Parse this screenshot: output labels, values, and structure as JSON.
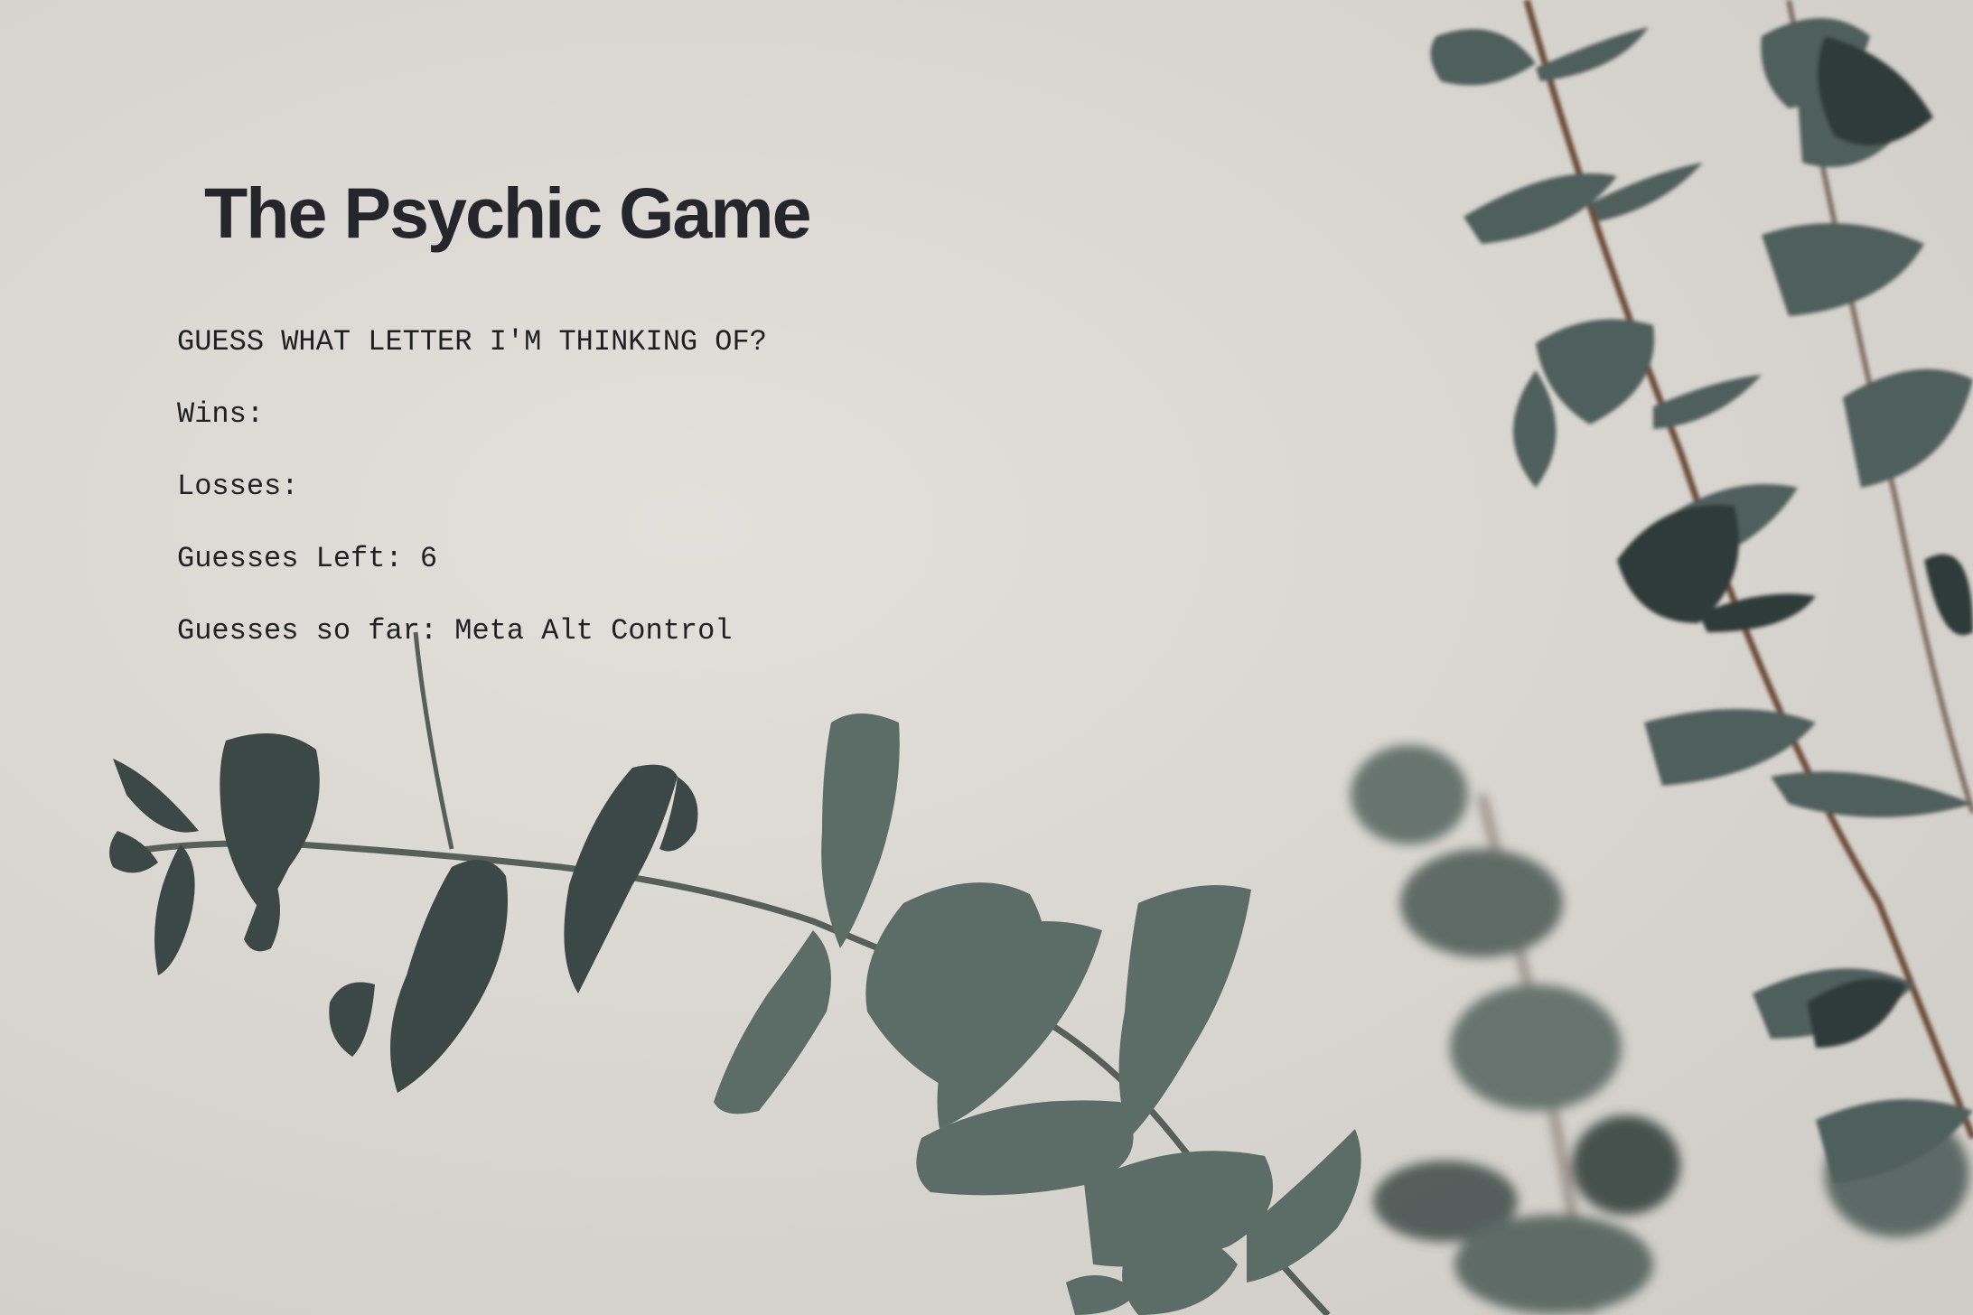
{
  "title": "The Psychic Game",
  "prompt": "GUESS WHAT LETTER I'M THINKING OF?",
  "stats": {
    "wins_label": "Wins:",
    "wins_value": "",
    "losses_label": "Losses:",
    "losses_value": "",
    "guesses_left_label": "Guesses Left:",
    "guesses_left_value": "6",
    "guesses_so_far_label": "Guesses so far:",
    "guesses_so_far_value": "Meta Alt Control"
  },
  "colors": {
    "background": "#d9d6d1",
    "leaf": "#4f5f5b",
    "leaf_dark": "#2f3a37",
    "stem": "#6b4a35",
    "text": "#24262b"
  }
}
